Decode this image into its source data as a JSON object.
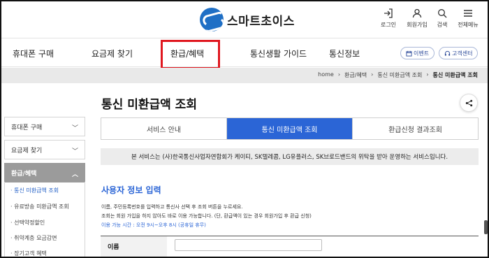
{
  "header": {
    "logo_text": "스마트초이스",
    "utils": [
      {
        "icon": "login-icon",
        "label": "로그인"
      },
      {
        "icon": "user-icon",
        "label": "회원가입"
      },
      {
        "icon": "search-icon",
        "label": "검색"
      },
      {
        "icon": "menu-icon",
        "label": "전체메뉴"
      }
    ]
  },
  "nav": {
    "items": [
      "휴대폰 구매",
      "요금제 찾기",
      "환급/혜택",
      "통신생활 가이드",
      "통신정보"
    ],
    "event_label": "이벤트",
    "support_label": "고객센터"
  },
  "breadcrumb": [
    "home",
    "환급/혜택",
    "통신 미환급액 조회",
    "통신 미환급액 조회"
  ],
  "page_title": "통신 미환급액 조회",
  "sidebar": {
    "items": [
      "휴대폰 구매",
      "요금제 찾기",
      "환급/혜택"
    ],
    "sub_items": [
      "· 통신 미환급액 조회",
      "· 유료방송 미환급액 조회",
      "· 선택약정할인",
      "· 취약계층 요금감면",
      "· 장기고객 혜택"
    ]
  },
  "tabs": [
    "서비스 안내",
    "통신 미환급액 조회",
    "환급신청 결과조회"
  ],
  "notice": "본 서비스는 (사)한국통신사업자연합회가 케이티, SK텔레콤, LG유플러스, SK브로드밴드의 위탁을 받아 운영하는 서비스입니다.",
  "section": {
    "title": "사용자 정보 입력",
    "desc1": "이름, 주민등록번호를 입력하고 통신사 선택 후 조회 버튼을 누르세요.",
    "desc2": "조회는 회원 가입을 하지 않아도 바로 이용 가능합니다. (단, 환급액이 있는 경우 회원가입 후 환급 신청)",
    "hours": "이용 가능 시간 : 오전 9시~오후 8시 (공휴일 휴무)"
  },
  "form": {
    "name_label": "이름",
    "name_value": ""
  },
  "colors": {
    "accent": "#2b65d6",
    "highlight": "#e0171f",
    "sidebar_active": "#9b9b9b"
  }
}
